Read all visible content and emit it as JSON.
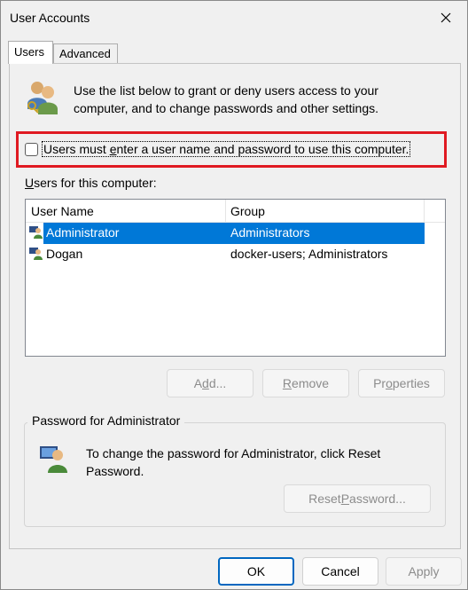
{
  "window": {
    "title": "User Accounts"
  },
  "tabs": [
    {
      "label": "Users"
    },
    {
      "label": "Advanced"
    }
  ],
  "intro": {
    "text": "Use the list below to grant or deny users access to your computer, and to change passwords and other settings."
  },
  "checkbox": {
    "label_pre": "Users must ",
    "label_key": "e",
    "label_post": "nter a user name and password to use this computer.",
    "checked": false
  },
  "users_list": {
    "label_key": "U",
    "label_rest": "sers for this computer:",
    "columns": [
      "User Name",
      "Group"
    ],
    "rows": [
      {
        "name": "Administrator",
        "group": "Administrators",
        "selected": true
      },
      {
        "name": "Dogan",
        "group": "docker-users; Administrators",
        "selected": false
      }
    ]
  },
  "list_buttons": {
    "add": {
      "pre": "A",
      "key": "d",
      "post": "d..."
    },
    "remove": {
      "key": "R",
      "post": "emove"
    },
    "properties": {
      "pre": "Pr",
      "key": "o",
      "post": "perties"
    }
  },
  "password_group": {
    "title": "Password for Administrator",
    "text": "To change the password for Administrator, click Reset Password.",
    "reset": {
      "pre": "Reset ",
      "key": "P",
      "post": "assword..."
    }
  },
  "footer": {
    "ok": "OK",
    "cancel": "Cancel",
    "apply": "Apply"
  },
  "colors": {
    "selection": "#0078d7",
    "highlight_border": "#e01a22",
    "primary_border": "#0067c0"
  },
  "icons": {
    "users_icon": "users-icon",
    "user_icon": "user-icon",
    "key_user_icon": "password-user-icon",
    "close_icon": "close-icon"
  }
}
